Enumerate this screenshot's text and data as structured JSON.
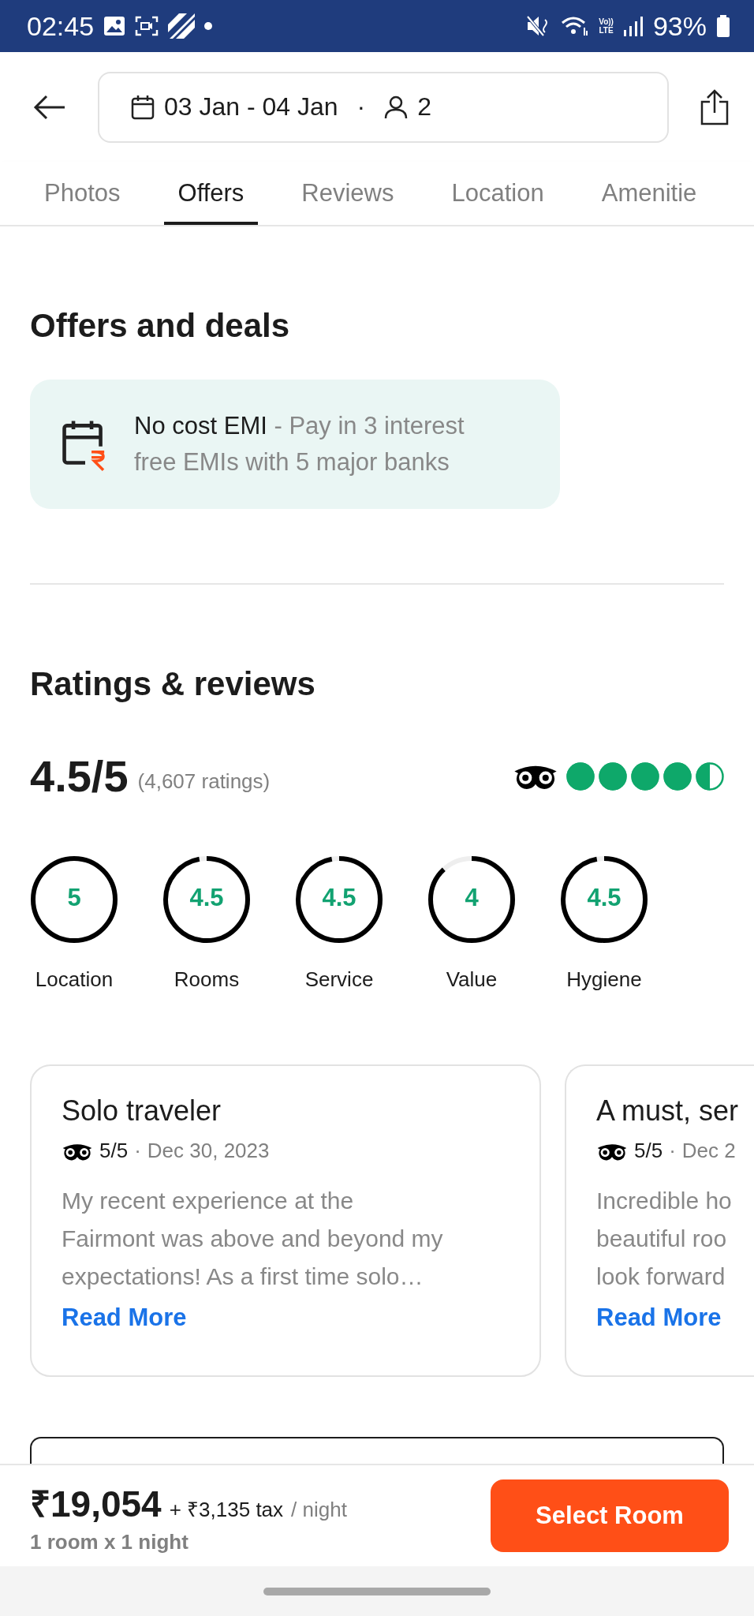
{
  "status_bar": {
    "time": "02:45",
    "volte": [
      "Vo))",
      "LTE"
    ],
    "battery": "93%"
  },
  "header": {
    "dates": "03 Jan - 04 Jan",
    "separator": "·",
    "guests": "2"
  },
  "tabs": [
    {
      "label": "Photos",
      "selected": false
    },
    {
      "label": "Offers",
      "selected": true
    },
    {
      "label": "Reviews",
      "selected": false
    },
    {
      "label": "Location",
      "selected": false
    },
    {
      "label": "Amenitie",
      "selected": false
    }
  ],
  "offers": {
    "title": "Offers and deals",
    "items": [
      {
        "title": "No cost EMI",
        "description": " - Pay in 3 interest free EMIs with 5 major banks"
      }
    ]
  },
  "ratings": {
    "title": "Ratings & reviews",
    "score": "4.5/5",
    "count": "(4,607 ratings)",
    "stars": 4.5,
    "categories": [
      {
        "value": "5",
        "label": "Location",
        "level": 1
      },
      {
        "value": "4.5",
        "label": "Rooms",
        "level": 0.97
      },
      {
        "value": "4.5",
        "label": "Service",
        "level": 0.97
      },
      {
        "value": "4",
        "label": "Value",
        "level": 0.88
      },
      {
        "value": "4.5",
        "label": "Hygiene",
        "level": 0.97
      }
    ]
  },
  "reviews": [
    {
      "title": "Solo traveler",
      "score": "5/5",
      "separator": "·",
      "date": "Dec 30, 2023",
      "body_lines": [
        "My recent experience at the",
        "Fairmont was above and beyond my",
        "expectations! As a first time solo…"
      ],
      "link": "Read More"
    },
    {
      "title": "A must, ser",
      "score": "5/5",
      "separator": "·",
      "date": "Dec 2",
      "body_lines": [
        "Incredible ho",
        "beautiful roo",
        "look forward"
      ],
      "link": "Read More"
    }
  ],
  "price_bar": {
    "price": "₹19,054",
    "tax": "+ ₹3,135 tax",
    "unit": "/ night",
    "summary": "1 room x 1 night",
    "button": "Select Room"
  }
}
